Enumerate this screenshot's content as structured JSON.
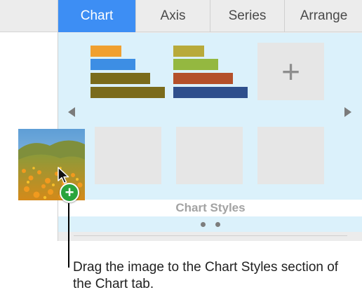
{
  "tabs": [
    {
      "label": "Chart",
      "active": true
    },
    {
      "label": "Axis",
      "active": false
    },
    {
      "label": "Series",
      "active": false
    },
    {
      "label": "Arrange",
      "active": false
    }
  ],
  "chart_styles": {
    "section_label": "Chart Styles",
    "style_thumbnails": [
      {
        "name": "style-1",
        "colors": [
          "#f0a030",
          "#3d8ee4",
          "#7a6b1b",
          "#7a6b1b"
        ]
      },
      {
        "name": "style-2",
        "colors": [
          "#b8aa3a",
          "#94b840",
          "#b4502a",
          "#2e4f8c"
        ]
      },
      {
        "name": "add-style",
        "icon": "plus-icon"
      },
      {
        "name": "empty-1"
      },
      {
        "name": "empty-2"
      },
      {
        "name": "empty-3"
      }
    ],
    "page_indicator": {
      "pages": 2
    }
  },
  "icons": {
    "previous": "chevron-left-icon",
    "next": "chevron-right-icon",
    "add": "plus-icon",
    "drag_badge": "plus-circle-icon",
    "cursor": "arrow-cursor-icon"
  },
  "dragged_image": {
    "description_icon": "photo-thumbnail"
  },
  "badge_symbol": "+",
  "caption": "Drag the image to the Chart Styles section of the Chart tab."
}
